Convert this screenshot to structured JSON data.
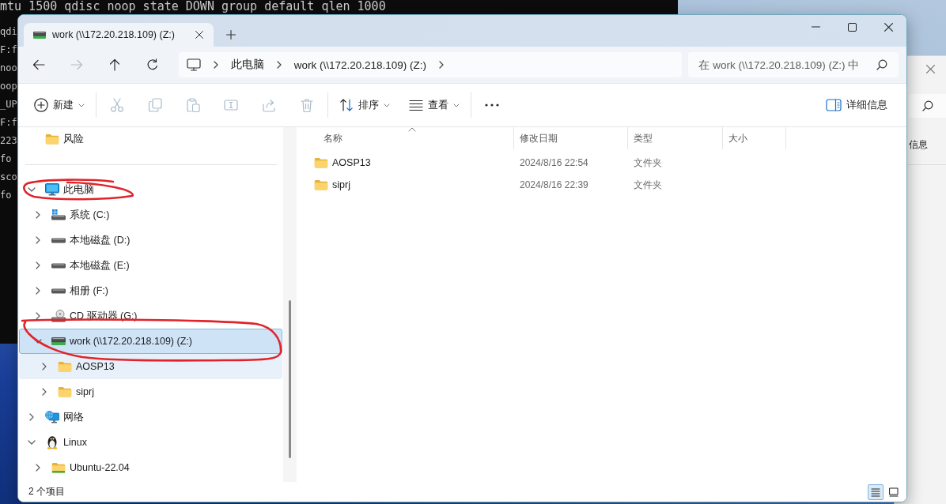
{
  "terminal": {
    "lines": [
      "mtu 1500 qdisc noop state DOWN group default qlen 1000",
      "qdi",
      "F:f",
      "noo",
      "oop",
      "_UP",
      "F:f",
      "223",
      "fo",
      "sco",
      "fo"
    ]
  },
  "side_window": {
    "text": "信息"
  },
  "explorer": {
    "tabs": [
      {
        "label": "work (\\\\172.20.218.109) (Z:)",
        "selected": true
      }
    ],
    "nav_buttons": [
      {
        "kind": "back",
        "disabled": false
      },
      {
        "kind": "forward",
        "disabled": true
      },
      {
        "kind": "up",
        "disabled": false
      },
      {
        "kind": "refresh",
        "disabled": false
      }
    ],
    "breadcrumbs": [
      {
        "label": "此电脑"
      },
      {
        "label": "work (\\\\172.20.218.109) (Z:)"
      }
    ],
    "search": {
      "placeholder": "在 work (\\\\172.20.218.109) (Z:) 中"
    },
    "toolbar": {
      "items": [
        {
          "kind": "new",
          "label": "新建",
          "disabled": false,
          "dropdown": true
        },
        {
          "kind": "separator"
        },
        {
          "kind": "cut",
          "disabled": true,
          "dropdown": false
        },
        {
          "kind": "copy",
          "disabled": true,
          "dropdown": false
        },
        {
          "kind": "paste",
          "disabled": true,
          "dropdown": false
        },
        {
          "kind": "rename",
          "disabled": true,
          "dropdown": false
        },
        {
          "kind": "share",
          "disabled": true,
          "dropdown": false
        },
        {
          "kind": "delete",
          "disabled": true,
          "dropdown": false
        },
        {
          "kind": "separator"
        },
        {
          "kind": "sort",
          "label": "排序",
          "disabled": false,
          "dropdown": true
        },
        {
          "kind": "view",
          "label": "查看",
          "disabled": false,
          "dropdown": true
        },
        {
          "kind": "separator"
        },
        {
          "kind": "more",
          "disabled": false,
          "dropdown": false
        }
      ],
      "details_button": {
        "label": "详细信息"
      }
    }
  },
  "sidebar": {
    "quick_access": [
      {
        "label": "风险",
        "kind": "folder"
      }
    ],
    "tree": [
      {
        "label": "此电脑",
        "kind": "pc",
        "expanded": true,
        "selected": false,
        "hovered": false,
        "circled": true,
        "children": [
          {
            "label": "系统 (C:)",
            "kind": "system-drive",
            "expanded": false,
            "selected": false,
            "hovered": false,
            "circled": false
          },
          {
            "label": "本地磁盘 (D:)",
            "kind": "drive",
            "expanded": false,
            "selected": false,
            "hovered": false,
            "circled": false
          },
          {
            "label": "本地磁盘 (E:)",
            "kind": "drive",
            "expanded": false,
            "selected": false,
            "hovered": false,
            "circled": false
          },
          {
            "label": "相册 (F:)",
            "kind": "drive",
            "expanded": false,
            "selected": false,
            "hovered": false,
            "circled": false
          },
          {
            "label": "CD 驱动器 (G:)",
            "kind": "cd-drive",
            "expanded": false,
            "selected": false,
            "hovered": false,
            "circled": false
          },
          {
            "label": "work (\\\\172.20.218.109) (Z:)",
            "kind": "network-drive",
            "expanded": true,
            "selected": true,
            "hovered": false,
            "circled": true,
            "children": [
              {
                "label": "AOSP13",
                "kind": "folder",
                "expanded": false,
                "selected": false,
                "hovered": true,
                "circled": false
              },
              {
                "label": "siprj",
                "kind": "folder",
                "expanded": false,
                "selected": false,
                "hovered": false,
                "circled": false
              }
            ]
          }
        ]
      },
      {
        "label": "网络",
        "kind": "network",
        "expanded": false,
        "selected": false,
        "hovered": false,
        "circled": false
      },
      {
        "label": "Linux",
        "kind": "linux",
        "expanded": true,
        "selected": false,
        "hovered": false,
        "circled": false,
        "children": [
          {
            "label": "Ubuntu-22.04",
            "kind": "linux-folder",
            "expanded": false,
            "selected": false,
            "hovered": false,
            "circled": false
          }
        ]
      }
    ]
  },
  "file_list": {
    "columns": [
      {
        "label": "名称",
        "sorted": true
      },
      {
        "label": "修改日期",
        "sorted": false
      },
      {
        "label": "类型",
        "sorted": false
      },
      {
        "label": "大小",
        "sorted": false
      }
    ],
    "rows": [
      {
        "name": "AOSP13",
        "modified": "2024/8/16 22:54",
        "type": "文件夹"
      },
      {
        "name": "siprj",
        "modified": "2024/8/16 22:39",
        "type": "文件夹"
      }
    ]
  },
  "status_bar": {
    "item_count": "2 个项目",
    "view_buttons": [
      {
        "kind": "details",
        "selected": true
      },
      {
        "kind": "tiles",
        "selected": false
      }
    ]
  }
}
